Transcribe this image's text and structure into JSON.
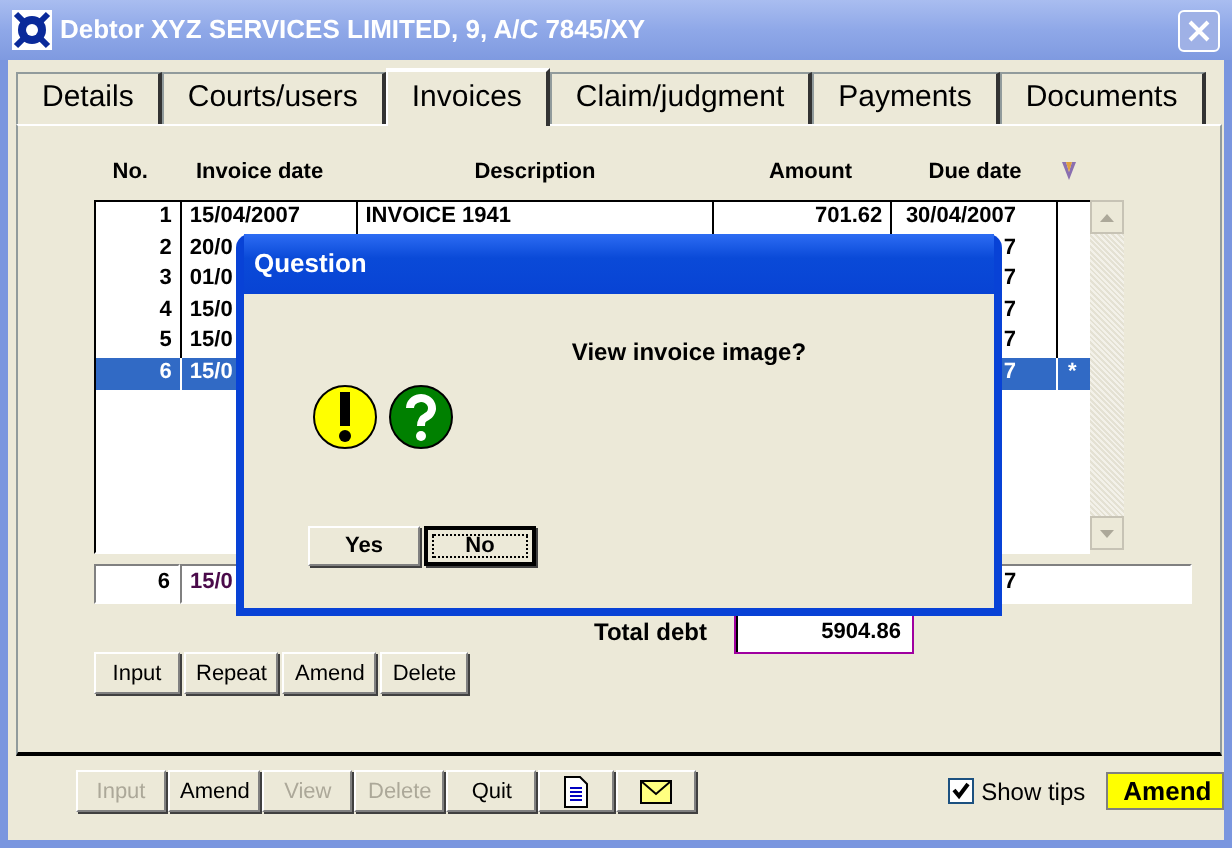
{
  "window": {
    "title": "Debtor XYZ SERVICES LIMITED, 9,  A/C  7845/XY"
  },
  "tabs": [
    {
      "label": "Details",
      "selected": false
    },
    {
      "label": "Courts/users",
      "selected": false
    },
    {
      "label": "Invoices",
      "selected": true
    },
    {
      "label": "Claim/judgment",
      "selected": false
    },
    {
      "label": "Payments",
      "selected": false
    },
    {
      "label": "Documents",
      "selected": false
    }
  ],
  "table": {
    "columns": [
      "No.",
      "Invoice date",
      "Description",
      "Amount",
      "Due date"
    ],
    "rows": [
      {
        "no": "1",
        "date": "15/04/2007",
        "description": "INVOICE 1941",
        "amount": "701.62",
        "due": "30/04/2007",
        "selected": false
      },
      {
        "no": "2",
        "date": "20/0",
        "due": "7",
        "selected": false
      },
      {
        "no": "3",
        "date": "01/0",
        "due": "7",
        "selected": false
      },
      {
        "no": "4",
        "date": "15/0",
        "due": "7",
        "selected": false
      },
      {
        "no": "5",
        "date": "15/0",
        "due": "7",
        "selected": false
      },
      {
        "no": "6",
        "date": "15/0",
        "due": "7",
        "marker": "*",
        "selected": true
      }
    ]
  },
  "summary_row": {
    "no": "6",
    "date": "15/0",
    "due": "7"
  },
  "total": {
    "label": "Total debt",
    "value": "5904.86"
  },
  "row_buttons": [
    "Input",
    "Repeat",
    "Amend",
    "Delete"
  ],
  "dialog": {
    "title": "Question",
    "message": "View invoice image?",
    "buttons": [
      {
        "label": "Yes",
        "focused": false
      },
      {
        "label": "No",
        "focused": true
      }
    ]
  },
  "toolbar": [
    {
      "kind": "text",
      "label": "Input",
      "disabled": true
    },
    {
      "kind": "text",
      "label": "Amend",
      "disabled": false
    },
    {
      "kind": "text",
      "label": "View",
      "disabled": true
    },
    {
      "kind": "text",
      "label": "Delete",
      "disabled": true
    },
    {
      "kind": "text",
      "label": "Quit",
      "disabled": false
    },
    {
      "kind": "document",
      "disabled": false
    },
    {
      "kind": "mail",
      "disabled": false
    }
  ],
  "show_tips": {
    "label": "Show tips",
    "checked": true
  },
  "mode": "Amend"
}
